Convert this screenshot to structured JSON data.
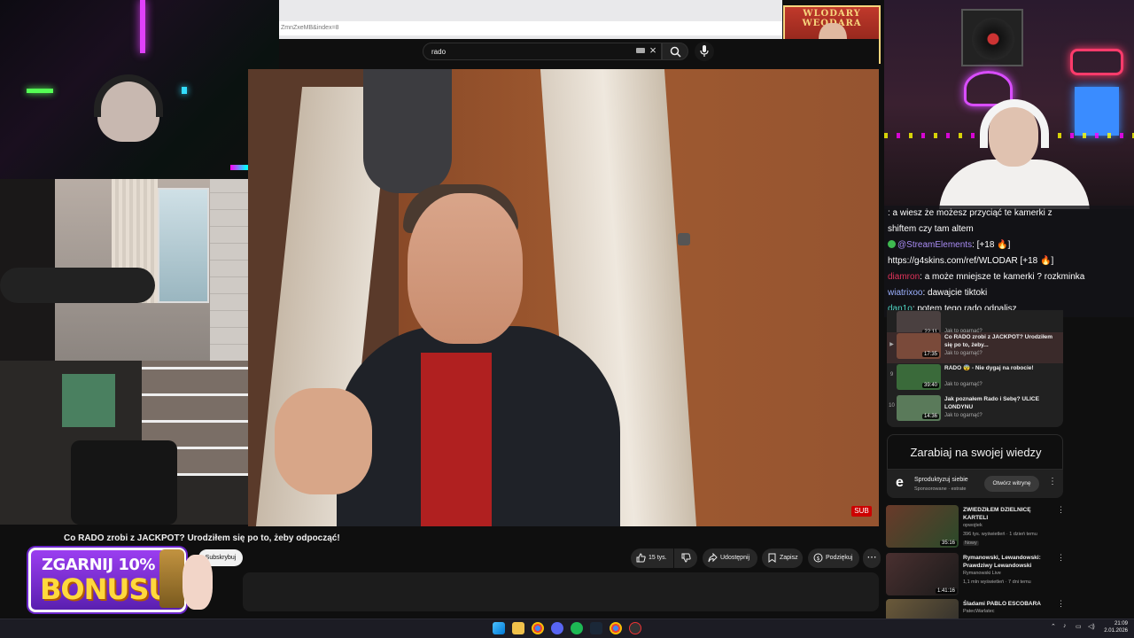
{
  "browser": {
    "url_fragment": "ZmnZxeMB&index=8"
  },
  "search": {
    "value": "rado"
  },
  "poster": {
    "title": "WLODARY WEODARA"
  },
  "video": {
    "sub_badge": "SUB",
    "title": "Co RADO zrobi z JACKPOT? Urodziłem się po to, żeby odpocząć!",
    "subscribe_label": "Subskrybuj",
    "like_count": "15 tys.",
    "share_label": "Udostępnij",
    "save_label": "Zapisz",
    "thanks_label": "Podziękuj",
    "more_label": "⋯"
  },
  "promo": {
    "line1": "ZGARNIJ 10%",
    "line2": "BONUSU"
  },
  "chat": {
    "messages": [
      {
        "user": "",
        "text": ": a wiesz że możesz przyciąć te kamerki z"
      },
      {
        "user": "",
        "text": "shiftem czy tam altem"
      },
      {
        "user": "@StreamElements",
        "text": ": [+18 🔥]"
      },
      {
        "user": "",
        "text": "https://g4skins.com/ref/WLODAR [+18 🔥]"
      },
      {
        "user": "diamron",
        "text": ": a może mniejsze te kamerki ? rozkminka"
      },
      {
        "user": "wiatrixoo",
        "text": ": dawajcie tiktoki"
      },
      {
        "user": "dan1o",
        "text": ": potem tego rado odpalisz"
      }
    ]
  },
  "playlist": {
    "items": [
      {
        "num": "",
        "duration": "22:11",
        "title": "",
        "sub": "Jak to ogarnąć?",
        "active": false
      },
      {
        "num": "",
        "duration": "17:35",
        "title": "Co RADO zrobi z JACKPOT? Urodziłem się po to, żeby...",
        "sub": "Jak to ogarnąć?",
        "active": true
      },
      {
        "num": "9",
        "duration": "39:40",
        "title": "RADO 😨 - Nie dygaj na robocie!",
        "sub": "Jak to ogarnąć?",
        "active": false
      },
      {
        "num": "10",
        "duration": "14:36",
        "title": "Jak poznałem Rado i Sebę? ULICE LONDYNU",
        "sub": "Jak to ogarnąć?",
        "active": false
      }
    ]
  },
  "ad": {
    "banner": "Zarabiaj na swojej wiedzy",
    "logo": "e",
    "name": "Sproduktyzuj siebie",
    "sponsored": "Sponsorowane · estrate",
    "button": "Otwórz witrynę"
  },
  "recommendations": [
    {
      "title": "ZWIEDZIŁEM DZIELNICĘ KARTELI",
      "channel": "opwojtek",
      "meta": "396 tys. wyświetleń · 1 dzień temu",
      "badge": "Nowy",
      "duration": "35:16",
      "thumb_color": "#6a3a2a"
    },
    {
      "title": "Rymanowski, Lewandowski: Prawdziwy Lewandowski",
      "channel": "Rymanowski Live",
      "meta": "1,1 mln wyświetleń · 7 dni temu",
      "badge": "",
      "duration": "1:41:16",
      "thumb_color": "#4a3030"
    },
    {
      "title": "Śladami PABLO ESCOBARA",
      "channel": "PatecWarlatec",
      "meta": "",
      "badge": "",
      "duration": "",
      "thumb_color": "#6b5a3a"
    }
  ],
  "clock": {
    "time": "21:09",
    "date": "2.01.2026"
  }
}
